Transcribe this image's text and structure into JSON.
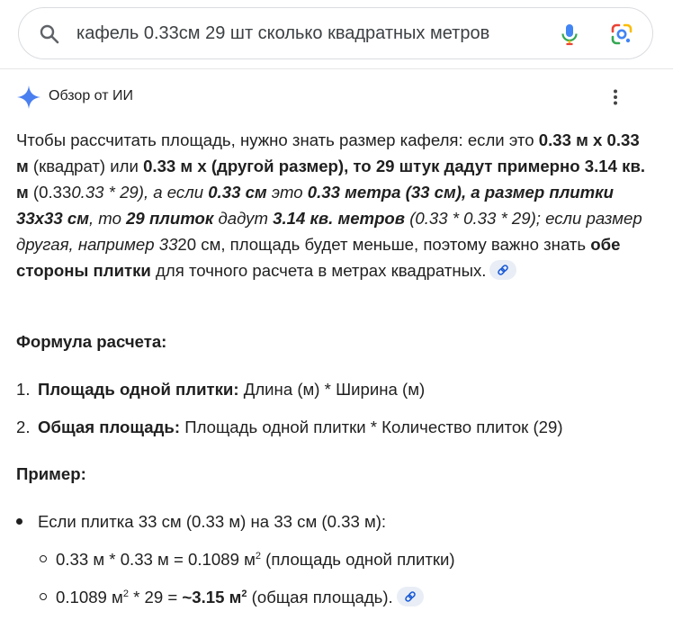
{
  "search": {
    "query": "кафель 0.33см 29 шт сколько квадратных метров"
  },
  "ai_overview": {
    "title": "Обзор от ИИ",
    "para": [
      {
        "t": "Чтобы рассчитать площадь, нужно знать размер кафеля: если это ",
        "s": ""
      },
      {
        "t": "0.33 м х 0.33 м",
        "s": "b"
      },
      {
        "t": " (квадрат) или ",
        "s": ""
      },
      {
        "t": "0.33 м х (другой размер), то 29 штук дадут примерно 3.14 кв. м",
        "s": "b"
      },
      {
        "t": " (0.33",
        "s": ""
      },
      {
        "t": "0.33 * 29), а если ",
        "s": "i"
      },
      {
        "t": "0.33 см",
        "s": "bi"
      },
      {
        "t": " это ",
        "s": "i"
      },
      {
        "t": "0.33 метра (33 см), а размер плитки 33x33 см",
        "s": "bi"
      },
      {
        "t": ", то ",
        "s": "i"
      },
      {
        "t": "29 плиток",
        "s": "bi"
      },
      {
        "t": " дадут ",
        "s": "i"
      },
      {
        "t": "3.14 кв. метров",
        "s": "bi"
      },
      {
        "t": " (0.33 * 0.33 * 29); если размер другая, например 33",
        "s": "i"
      },
      {
        "t": "20 см, площадь будет меньше, поэтому важно знать ",
        "s": ""
      },
      {
        "t": "обе стороны плитки",
        "s": "b"
      },
      {
        "t": " для точного расчета в метрах квадратных.",
        "s": ""
      }
    ],
    "formula_heading": "Формула расчета:",
    "formula": [
      {
        "num": "1.",
        "bold": "Площадь одной плитки:",
        "rest": " Длина (м) * Ширина (м)"
      },
      {
        "num": "2.",
        "bold": "Общая площадь:",
        "rest": " Площадь одной плитки * Количество плиток (29)"
      }
    ],
    "example_heading": "Пример:",
    "example_bullet": "Если плитка 33 см (0.33 м) на 33 см (0.33 м):",
    "sub1": {
      "a": "0.33 м * 0.33 м = 0.1089 м",
      "sup": "2",
      "b": " (площадь одной плитки)"
    },
    "sub2": {
      "a": "0.1089 м",
      "sup": "2",
      "b": " * 29 = ",
      "bold": "~3.15 м",
      "bold_sup": "2",
      "c": " (общая площадь)."
    }
  }
}
